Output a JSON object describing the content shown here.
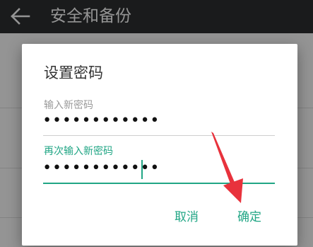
{
  "appbar": {
    "title": "安全和备份",
    "back_icon": "arrow-left-icon"
  },
  "dialog": {
    "title": "设置密码",
    "field1": {
      "label": "输入新密码",
      "value": "••••••••••••"
    },
    "field2": {
      "label": "再次输入新密码",
      "value": "••••••••••••"
    },
    "cancel_label": "取消",
    "ok_label": "确定"
  },
  "colors": {
    "appbar": "#2d2f31",
    "accent": "#21a685",
    "annotation_arrow": "#e8323c"
  },
  "annotation": {
    "type": "arrow",
    "points_to": "ok_button"
  }
}
